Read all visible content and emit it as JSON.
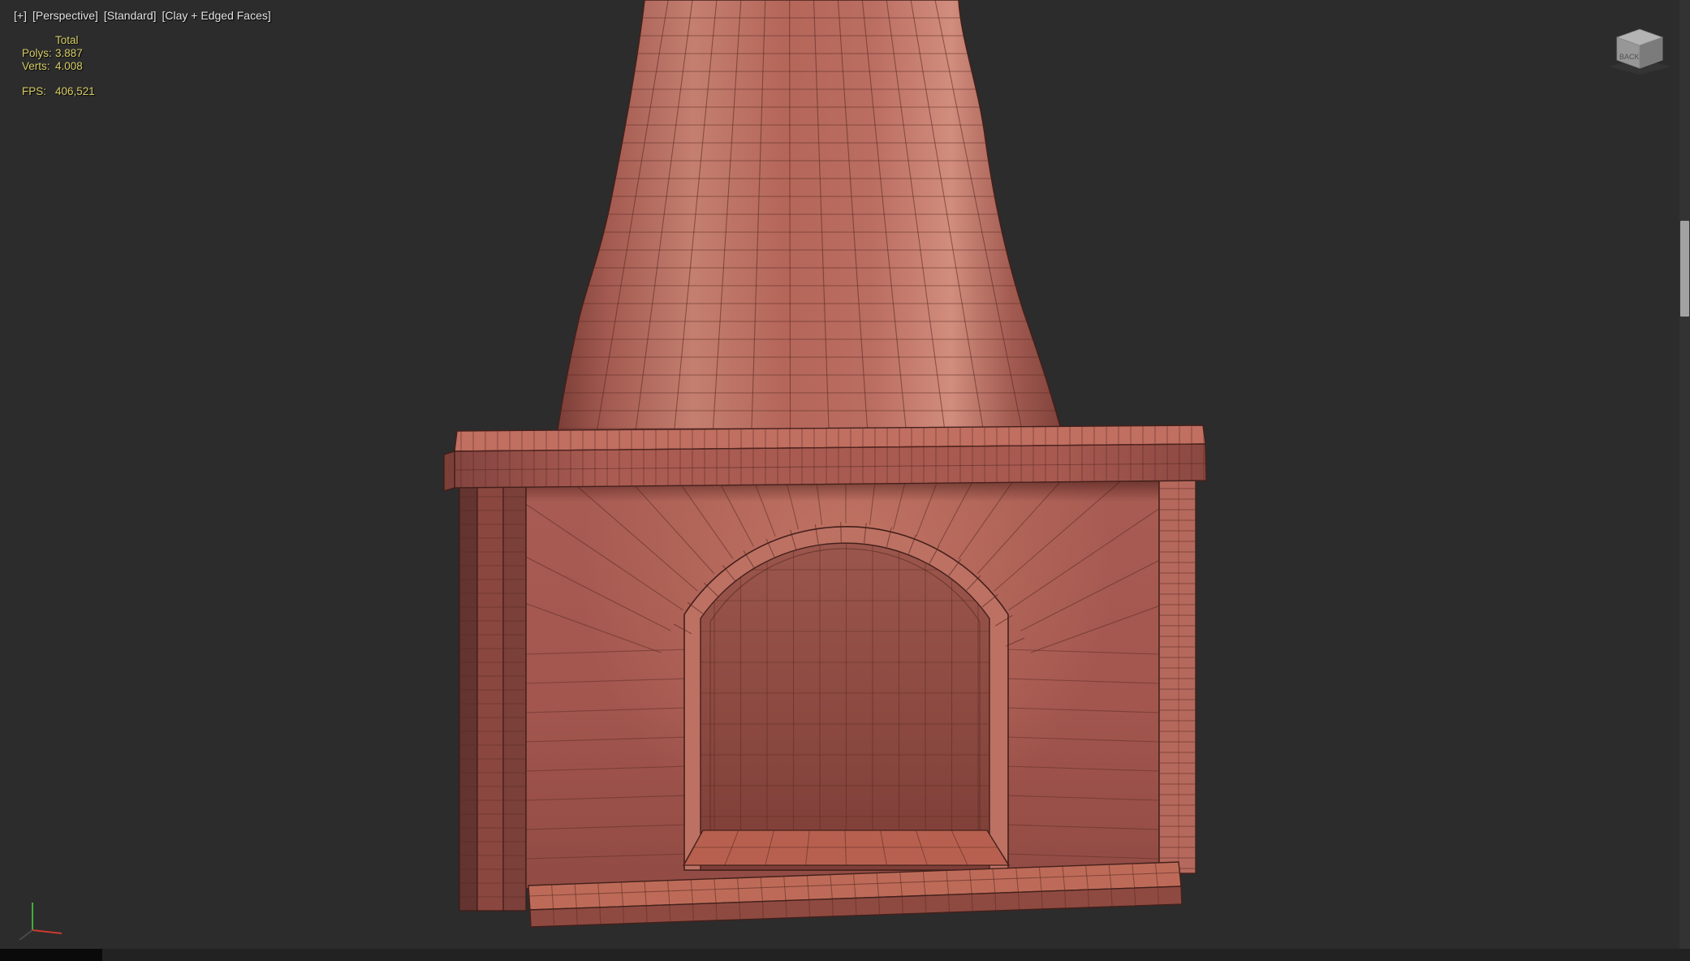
{
  "viewport_label": {
    "general_menu": "[+]",
    "point_of_view_menu": "[Perspective]",
    "standard_menu": "[Standard]",
    "shading_menu": "[Clay + Edged Faces]"
  },
  "statistics": {
    "header": "Total",
    "rows": [
      {
        "label": "Polys:",
        "value": "3.887"
      },
      {
        "label": "Verts:",
        "value": "4.008"
      }
    ],
    "fps": {
      "label": "FPS:",
      "value": "406,521"
    }
  },
  "viewcube": {
    "face_label": "BACK"
  },
  "scene": {
    "object": "fireplace with tapered chimney, clay + edged faces shading",
    "colors": {
      "background": "#2c2c2c",
      "clay": "#b2625a",
      "clay_highlight": "#d18d7d",
      "clay_shadow": "#7a3e37",
      "wire": "#54261f",
      "stats_text": "#d6cc66",
      "label_text": "#e2e2e2",
      "axis_x_red": "#cc3a2e",
      "axis_y_green": "#3fae3f"
    }
  }
}
